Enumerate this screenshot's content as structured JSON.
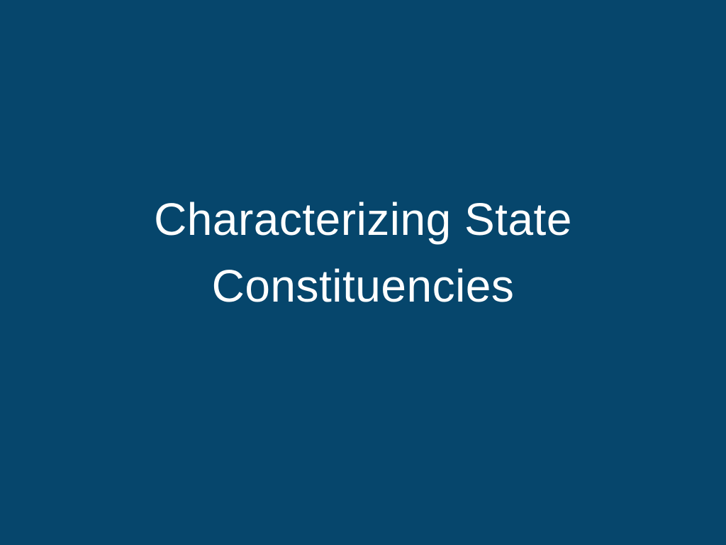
{
  "slide": {
    "background_color": "#06466c",
    "text_color": "#ffffff",
    "title_line_1": "Characterizing State",
    "title_line_2": "Constituencies"
  }
}
